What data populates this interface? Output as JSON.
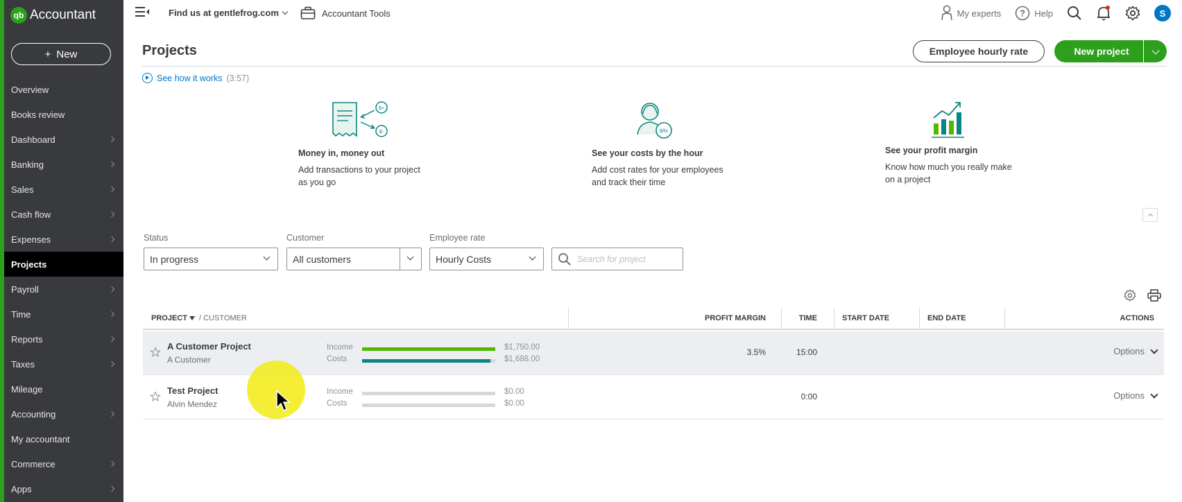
{
  "app": {
    "brand": "Accountant",
    "logo_text": "qb"
  },
  "sidebar": {
    "new_label": "New",
    "items": [
      {
        "label": "Overview",
        "chevron": false
      },
      {
        "label": "Books review",
        "chevron": false
      },
      {
        "label": "Dashboard",
        "chevron": true
      },
      {
        "label": "Banking",
        "chevron": true
      },
      {
        "label": "Sales",
        "chevron": true
      },
      {
        "label": "Cash flow",
        "chevron": true
      },
      {
        "label": "Expenses",
        "chevron": true
      },
      {
        "label": "Projects",
        "chevron": false,
        "active": true
      },
      {
        "label": "Payroll",
        "chevron": true
      },
      {
        "label": "Time",
        "chevron": true
      },
      {
        "label": "Reports",
        "chevron": true
      },
      {
        "label": "Taxes",
        "chevron": true
      },
      {
        "label": "Mileage",
        "chevron": false
      },
      {
        "label": "Accounting",
        "chevron": true
      },
      {
        "label": "My accountant",
        "chevron": false
      },
      {
        "label": "Commerce",
        "chevron": true
      },
      {
        "label": "Apps",
        "chevron": true
      }
    ]
  },
  "topbar": {
    "find_us": "Find us at gentlefrog.com",
    "tools": "Accountant Tools",
    "my_experts": "My experts",
    "help": "Help",
    "avatar_letter": "S"
  },
  "page": {
    "title": "Projects",
    "employee_rate_button": "Employee hourly rate",
    "new_project_button": "New project",
    "see_how": "See how it works",
    "see_how_duration": "(3:57)"
  },
  "features": [
    {
      "title": "Money in, money out",
      "desc": "Add transactions to your project as you go",
      "icon": "money-transactions-icon"
    },
    {
      "title": "See your costs by the hour",
      "desc": "Add cost rates for your employees and track their time",
      "icon": "costs-by-hour-icon"
    },
    {
      "title": "See your profit margin",
      "desc": "Know how much you really make on a project",
      "icon": "profit-margin-icon"
    }
  ],
  "filters": {
    "status_label": "Status",
    "status_value": "In progress",
    "customer_label": "Customer",
    "customer_value": "All customers",
    "rate_label": "Employee rate",
    "rate_value": "Hourly Costs",
    "search_placeholder": "Search for project"
  },
  "table": {
    "headers": {
      "project": "PROJECT",
      "customer": "/ CUSTOMER",
      "profit_margin": "PROFIT MARGIN",
      "time": "TIME",
      "start_date": "START DATE",
      "end_date": "END DATE",
      "actions": "ACTIONS"
    },
    "income_label": "Income",
    "costs_label": "Costs",
    "options_label": "Options",
    "rows": [
      {
        "project": "A Customer Project",
        "customer": "A Customer",
        "income": "$1,750.00",
        "costs": "$1,688.00",
        "income_fill": 1.0,
        "costs_fill": 0.965,
        "margin": "3.5%",
        "time": "15:00",
        "highlighted": true
      },
      {
        "project": "Test Project",
        "customer": "Alvin Mendez",
        "income": "$0.00",
        "costs": "$0.00",
        "income_fill": 0,
        "costs_fill": 0,
        "margin": "",
        "time": "0:00",
        "highlighted": false
      }
    ]
  },
  "colors": {
    "brand_green": "#2ca01c",
    "income_bar": "#53b700",
    "costs_bar": "#0d8484",
    "link": "#0077c5",
    "sidebar_bg": "#393a3d"
  }
}
